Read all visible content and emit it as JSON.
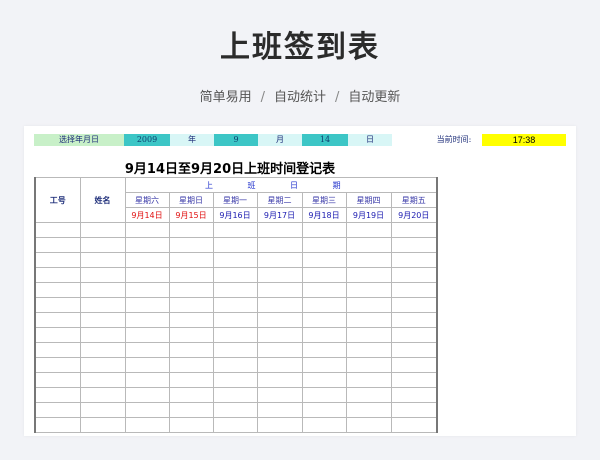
{
  "page": {
    "title": "上班签到表",
    "subtitle": [
      "简单易用",
      "自动统计",
      "自动更新"
    ],
    "separator": "/"
  },
  "selector": {
    "label": "选择年月日",
    "year": "2009",
    "year_unit": "年",
    "month": "9",
    "month_unit": "月",
    "day": "14",
    "day_unit": "日",
    "time_label": "当前时间:",
    "time": "17:38"
  },
  "record": {
    "title": "9月14日至9月20日上班时间登记表",
    "col_id": "工号",
    "col_name": "姓名",
    "col_shift": "上 班 日 期",
    "weekdays": [
      "星期六",
      "星期日",
      "星期一",
      "星期二",
      "星期三",
      "星期四",
      "星期五"
    ],
    "dates": [
      {
        "text": "9月14日",
        "weekend": true
      },
      {
        "text": "9月15日",
        "weekend": true
      },
      {
        "text": "9月16日",
        "weekend": false
      },
      {
        "text": "9月17日",
        "weekend": false
      },
      {
        "text": "9月18日",
        "weekend": false
      },
      {
        "text": "9月19日",
        "weekend": false
      },
      {
        "text": "9月20日",
        "weekend": false
      }
    ]
  },
  "colors": {
    "label_bg": "#c8f0c8",
    "value_bg": "#3cc6c6",
    "unit_bg": "#d8f6f6",
    "time_bg": "#ffff00",
    "weekend_text": "#e01010",
    "weekday_text": "#1a1ab0"
  }
}
